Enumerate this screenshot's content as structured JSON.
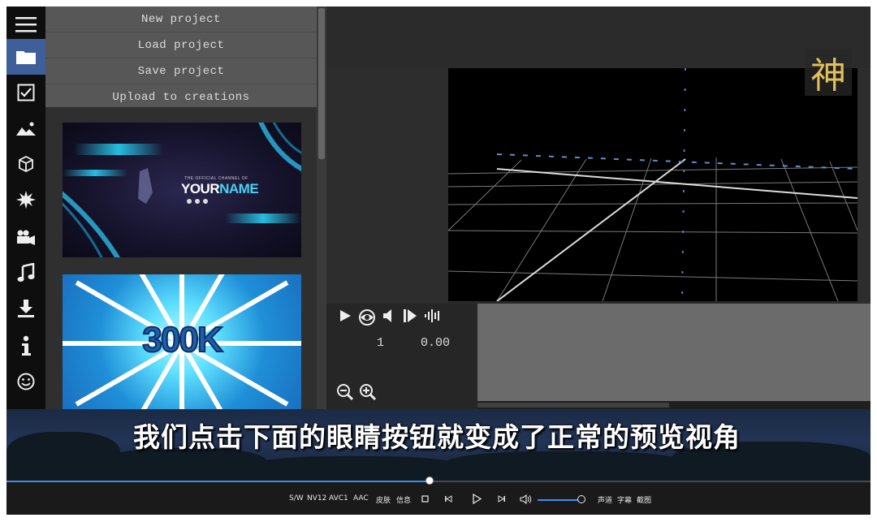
{
  "menu": {
    "items": [
      "New project",
      "Load project",
      "Save project",
      "Upload to creations"
    ]
  },
  "sidebar": {
    "icons": [
      "menu-icon",
      "folder-icon",
      "checkbox-icon",
      "image-icon",
      "cube-icon",
      "burst-icon",
      "camera-icon",
      "music-icon",
      "download-icon",
      "info-icon",
      "smiley-icon"
    ],
    "active": "folder-icon"
  },
  "gallery": {
    "thumb1": {
      "title_a": "YOUR",
      "title_b": "NAME",
      "sub": "THE OFFICIAL CHANNEL OF"
    },
    "thumb2": {
      "text": "300K"
    }
  },
  "controls": {
    "frame": "1",
    "time": "0.00",
    "icons": [
      "play-icon",
      "eye-icon",
      "speaker-icon",
      "step-forward-icon",
      "waveform-icon",
      "zoom-out-icon",
      "zoom-in-icon"
    ]
  },
  "subtitle": "我们点击下面的眼睛按钮就变成了正常的预览视角",
  "watermark": "神",
  "player": {
    "progress": 0.49,
    "volume": 1.0,
    "labels": {
      "sw": "S/W",
      "nv12": "NV12",
      "avc1": "AVC1",
      "aac": "AAC",
      "skin": "皮肤",
      "info": "信息",
      "channel": "声道",
      "caption": "字幕",
      "screenshot": "截图"
    },
    "colors": {
      "accent": "#3d8ff0"
    }
  }
}
